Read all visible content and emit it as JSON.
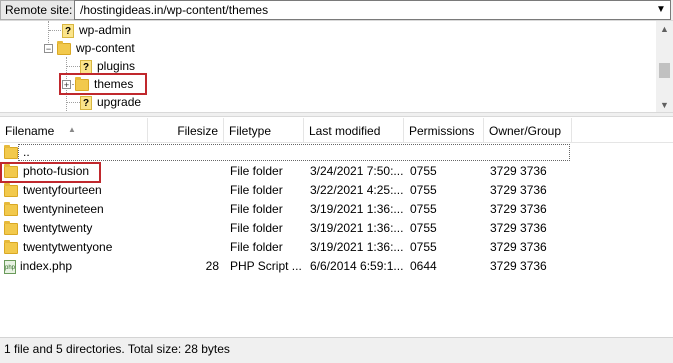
{
  "remote_site": {
    "label": "Remote site:",
    "path": "/hostingideas.in/wp-content/themes"
  },
  "tree": {
    "nodes": [
      {
        "label": "wp-admin",
        "icon": "unknown-folder-icon"
      },
      {
        "label": "wp-content",
        "icon": "folder-icon",
        "expanded": true
      },
      {
        "label": "plugins",
        "icon": "unknown-folder-icon"
      },
      {
        "label": "themes",
        "icon": "folder-icon",
        "highlighted": true
      },
      {
        "label": "upgrade",
        "icon": "unknown-folder-icon"
      }
    ]
  },
  "list": {
    "columns": [
      "Filename",
      "Filesize",
      "Filetype",
      "Last modified",
      "Permissions",
      "Owner/Group"
    ],
    "parent_label": "..",
    "rows": [
      {
        "name": "photo-fusion",
        "size": "",
        "type": "File folder",
        "modified": "3/24/2021 7:50:...",
        "perms": "0755",
        "owner": "3729 3736",
        "icon": "folder-icon",
        "highlighted": true
      },
      {
        "name": "twentyfourteen",
        "size": "",
        "type": "File folder",
        "modified": "3/22/2021 4:25:...",
        "perms": "0755",
        "owner": "3729 3736",
        "icon": "folder-icon"
      },
      {
        "name": "twentynineteen",
        "size": "",
        "type": "File folder",
        "modified": "3/19/2021 1:36:...",
        "perms": "0755",
        "owner": "3729 3736",
        "icon": "folder-icon"
      },
      {
        "name": "twentytwenty",
        "size": "",
        "type": "File folder",
        "modified": "3/19/2021 1:36:...",
        "perms": "0755",
        "owner": "3729 3736",
        "icon": "folder-icon"
      },
      {
        "name": "twentytwentyone",
        "size": "",
        "type": "File folder",
        "modified": "3/19/2021 1:36:...",
        "perms": "0755",
        "owner": "3729 3736",
        "icon": "folder-icon"
      },
      {
        "name": "index.php",
        "size": "28",
        "type": "PHP Script ...",
        "modified": "6/6/2014 6:59:1...",
        "perms": "0644",
        "owner": "3729 3736",
        "icon": "php-file-icon"
      }
    ]
  },
  "status": "1 file and 5 directories. Total size: 28 bytes",
  "colors": {
    "highlight_box": "#c0282d",
    "folder": "#f2c94c"
  }
}
